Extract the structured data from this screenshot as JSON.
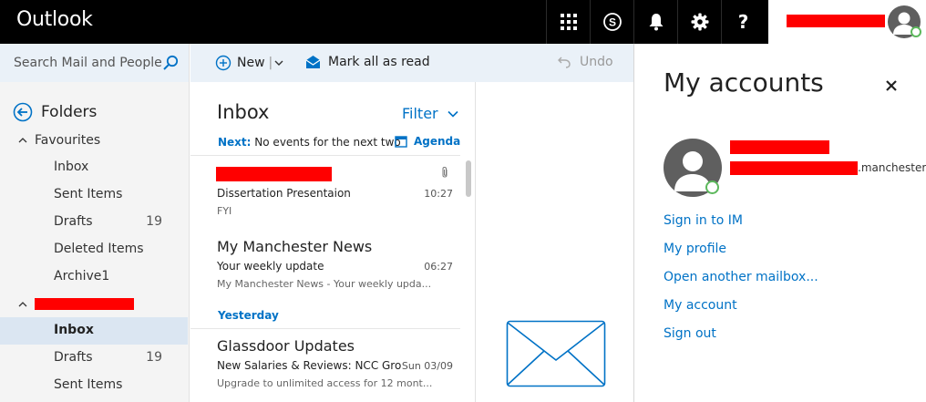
{
  "app": {
    "title": "Outlook"
  },
  "topbar": {
    "buttons": [
      "app-launcher-icon",
      "skype-icon",
      "bell-icon",
      "gear-icon",
      "help-icon"
    ],
    "help_label": "?"
  },
  "search": {
    "placeholder": "Search Mail and People"
  },
  "toolbar": {
    "new_label": "New",
    "new_separator": "|",
    "mark_read_label": "Mark all as read",
    "undo_label": "Undo"
  },
  "folders": {
    "title": "Folders",
    "favourites_label": "Favourites",
    "favourites": [
      {
        "label": "Inbox",
        "count": ""
      },
      {
        "label": "Sent Items",
        "count": ""
      },
      {
        "label": "Drafts",
        "count": "19"
      },
      {
        "label": "Deleted Items",
        "count": ""
      },
      {
        "label": "Archive1",
        "count": ""
      }
    ],
    "account_items": [
      {
        "label": "Inbox",
        "count": "",
        "selected": true
      },
      {
        "label": "Drafts",
        "count": "19"
      },
      {
        "label": "Sent Items",
        "count": ""
      }
    ]
  },
  "list": {
    "title": "Inbox",
    "filter_label": "Filter",
    "next_label": "Next:",
    "next_text": "No events for the next two",
    "agenda_label": "Agenda",
    "group_yesterday": "Yesterday",
    "messages": [
      {
        "sender": "",
        "subject": "Dissertation Presentaion",
        "time": "10:27",
        "preview": "FYI",
        "attachment": true
      },
      {
        "sender": "My Manchester News",
        "subject": "Your weekly update",
        "time": "06:27",
        "preview": "My Manchester News - Your weekly upda..."
      },
      {
        "sender": "Glassdoor Updates",
        "subject": "New Salaries & Reviews: NCC Gro",
        "time": "Sun 03/09",
        "preview": "Upgrade to unlimited access for 12 mont..."
      }
    ]
  },
  "accounts_panel": {
    "title": "My accounts",
    "email_suffix": ".manchester....",
    "links": [
      "Sign in to IM",
      "My profile",
      "Open another mailbox...",
      "My account",
      "Sign out"
    ]
  },
  "colors": {
    "accent": "#0072c6",
    "topbar": "#000000",
    "redaction": "#ff0000",
    "selected": "#dbe6f2"
  }
}
